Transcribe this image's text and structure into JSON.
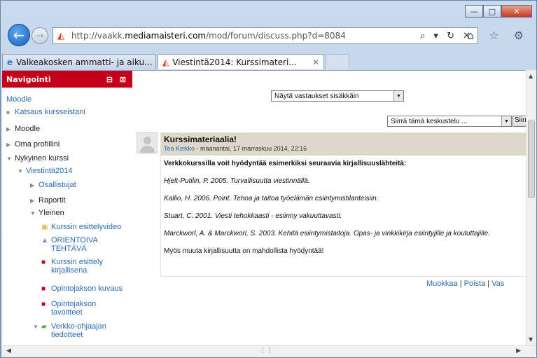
{
  "browser": {
    "url_prefix": "http://vaakk.",
    "url_domain": "mediamaisteri.com",
    "url_path": "/mod/forum/discuss.php?d=8084",
    "addr_tools": "⌕ ▾ ↻ ✕",
    "tabs": [
      {
        "label": "Valkeakosken ammatti- ja aiku..."
      },
      {
        "label": "Viestintä2014: Kurssimateri...",
        "close": "✕"
      }
    ],
    "window_controls": {
      "min": "—",
      "max": "□",
      "close": "✕"
    },
    "toolbar_icons": "⌂ ☆ ⚙"
  },
  "sidebar": {
    "title": "Navigointi",
    "controls": "⊟ ⊠",
    "items": [
      {
        "label": "Moodle"
      },
      {
        "label": "Katsaus kursseistani"
      },
      {
        "label": "Moodle"
      },
      {
        "label": "Oma profiilini"
      },
      {
        "label": "Nykyinen kurssi"
      },
      {
        "label": "Viestintä2014"
      },
      {
        "label": "Osallistujat"
      },
      {
        "label": "Raportit"
      },
      {
        "label": "Yleinen"
      },
      {
        "label": "Kurssin esittelyvideo"
      },
      {
        "label": "ORIENTOIVA",
        "label2": "TEHTÄVÄ"
      },
      {
        "label": "Kurssin esittely",
        "label2": "kirjallisena"
      },
      {
        "label": "Opintojakson kuvaus"
      },
      {
        "label": "Opintojakson",
        "label2": "tavoitteet"
      },
      {
        "label": "Verkko-ohjaajan",
        "label2": "tiedotteet"
      }
    ]
  },
  "main": {
    "display_mode": "Näytä vastaukset sisäkkäin",
    "move_select": "Siirrä tämä keskustelu ...",
    "move_button": "Siirrä",
    "post": {
      "title": "Kurssimateriaalia!",
      "author": "Tea Keikko",
      "date": " - maanantai, 17 marraskuu 2014, 22:16",
      "lead": "Verkkokurssilla voit hyödyntää esimerkiksi seuraavia kirjallisuuslähteitä:",
      "refs": [
        "Hjelt-Putilin, P. 2005. Turvallisuutta viestinnällä.",
        "Kallio, H. 2006. Point. Tehoa ja taitoa työelämän esiintymistilanteisiin.",
        "Stuart, C. 2001. Viesti tehokkaasti - esiinny vakuuttavasti.",
        "Marckworl, A. & Marckworl, S. 2003. Kehitä esiintymistaitoja. Opas- ja vinkkikirja esiintyjille ja kouluttajille."
      ],
      "closing": "Myös muuta kirjallisuutta on mahdollista hyödyntää!"
    },
    "commands": {
      "edit": "Muokkaa",
      "sep": " | ",
      "delete": "Poista",
      "reply": "Vas"
    }
  }
}
